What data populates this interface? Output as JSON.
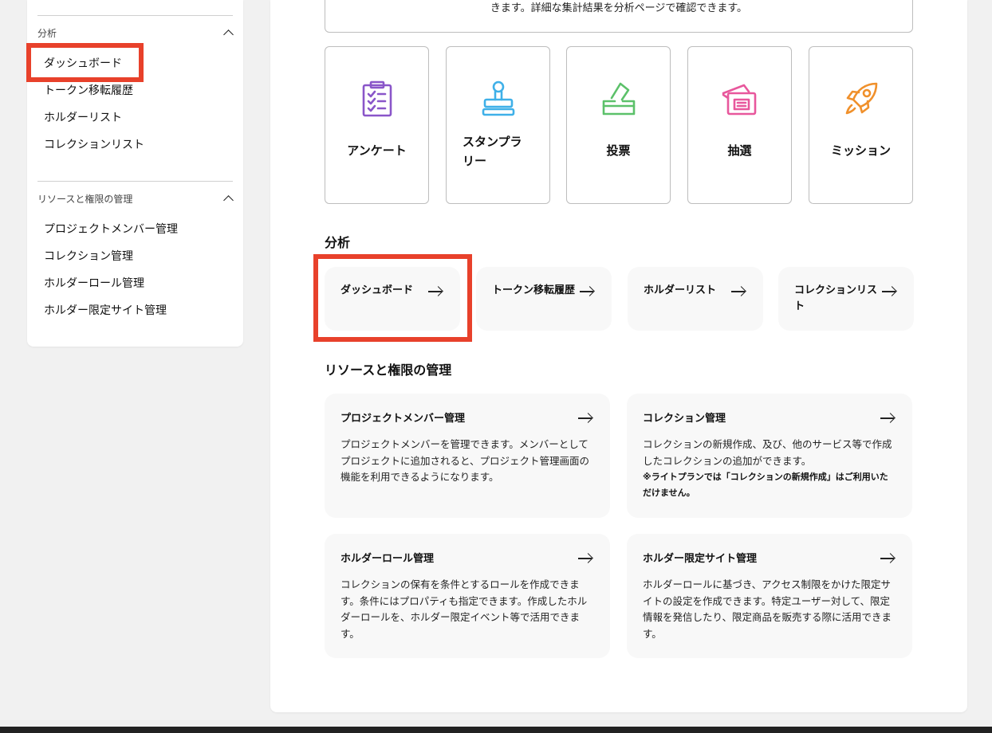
{
  "sidebar": {
    "sections": [
      {
        "title": "分析",
        "items": [
          {
            "label": "ダッシュボード"
          },
          {
            "label": "トークン移転履歴"
          },
          {
            "label": "ホルダーリスト"
          },
          {
            "label": "コレクションリスト"
          }
        ]
      },
      {
        "title": "リソースと権限の管理",
        "items": [
          {
            "label": "プロジェクトメンバー管理"
          },
          {
            "label": "コレクション管理"
          },
          {
            "label": "ホルダーロール管理"
          },
          {
            "label": "ホルダー限定サイト管理"
          }
        ]
      }
    ]
  },
  "main": {
    "top_box_text": "きます。詳細な集計結果を分析ページで確認できます。",
    "tiles": [
      {
        "label": "アンケート",
        "icon": "survey-clipboard-icon",
        "color": "#8a56c9"
      },
      {
        "label": "スタンプラリー",
        "icon": "stamp-icon",
        "color": "#3fb0e8"
      },
      {
        "label": "投票",
        "icon": "ballot-box-icon",
        "color": "#5cc16a"
      },
      {
        "label": "抽選",
        "icon": "lottery-box-icon",
        "color": "#e8579c"
      },
      {
        "label": "ミッション",
        "icon": "rocket-icon",
        "color": "#f0902b"
      }
    ],
    "analysis": {
      "title": "分析",
      "links": [
        {
          "label": "ダッシュボード"
        },
        {
          "label": "トークン移転履歴"
        },
        {
          "label": "ホルダーリスト"
        },
        {
          "label": "コレクションリスト"
        }
      ]
    },
    "resources": {
      "title": "リソースと権限の管理",
      "cards": [
        {
          "title": "プロジェクトメンバー管理",
          "text": "プロジェクトメンバーを管理できます。メンバーとしてプロジェクトに追加されると、プロジェクト管理画面の機能を利用できるようになります。",
          "note": ""
        },
        {
          "title": "コレクション管理",
          "text": "コレクションの新規作成、及び、他のサービス等で作成したコレクションの追加ができます。",
          "note": "※ライトプランでは「コレクションの新規作成」はご利用いただけません。"
        },
        {
          "title": "ホルダーロール管理",
          "text": "コレクションの保有を条件とするロールを作成できます。条件にはプロパティも指定できます。作成したホルダーロールを、ホルダー限定イベント等で活用できます。",
          "note": ""
        },
        {
          "title": "ホルダー限定サイト管理",
          "text": "ホルダーロールに基づき、アクセス制限をかけた限定サイトの設定を作成できます。特定ユーザー対して、限定情報を発信したり、限定商品を販売する際に活用できます。",
          "note": ""
        }
      ]
    }
  },
  "highlight_color": "#e8412b"
}
